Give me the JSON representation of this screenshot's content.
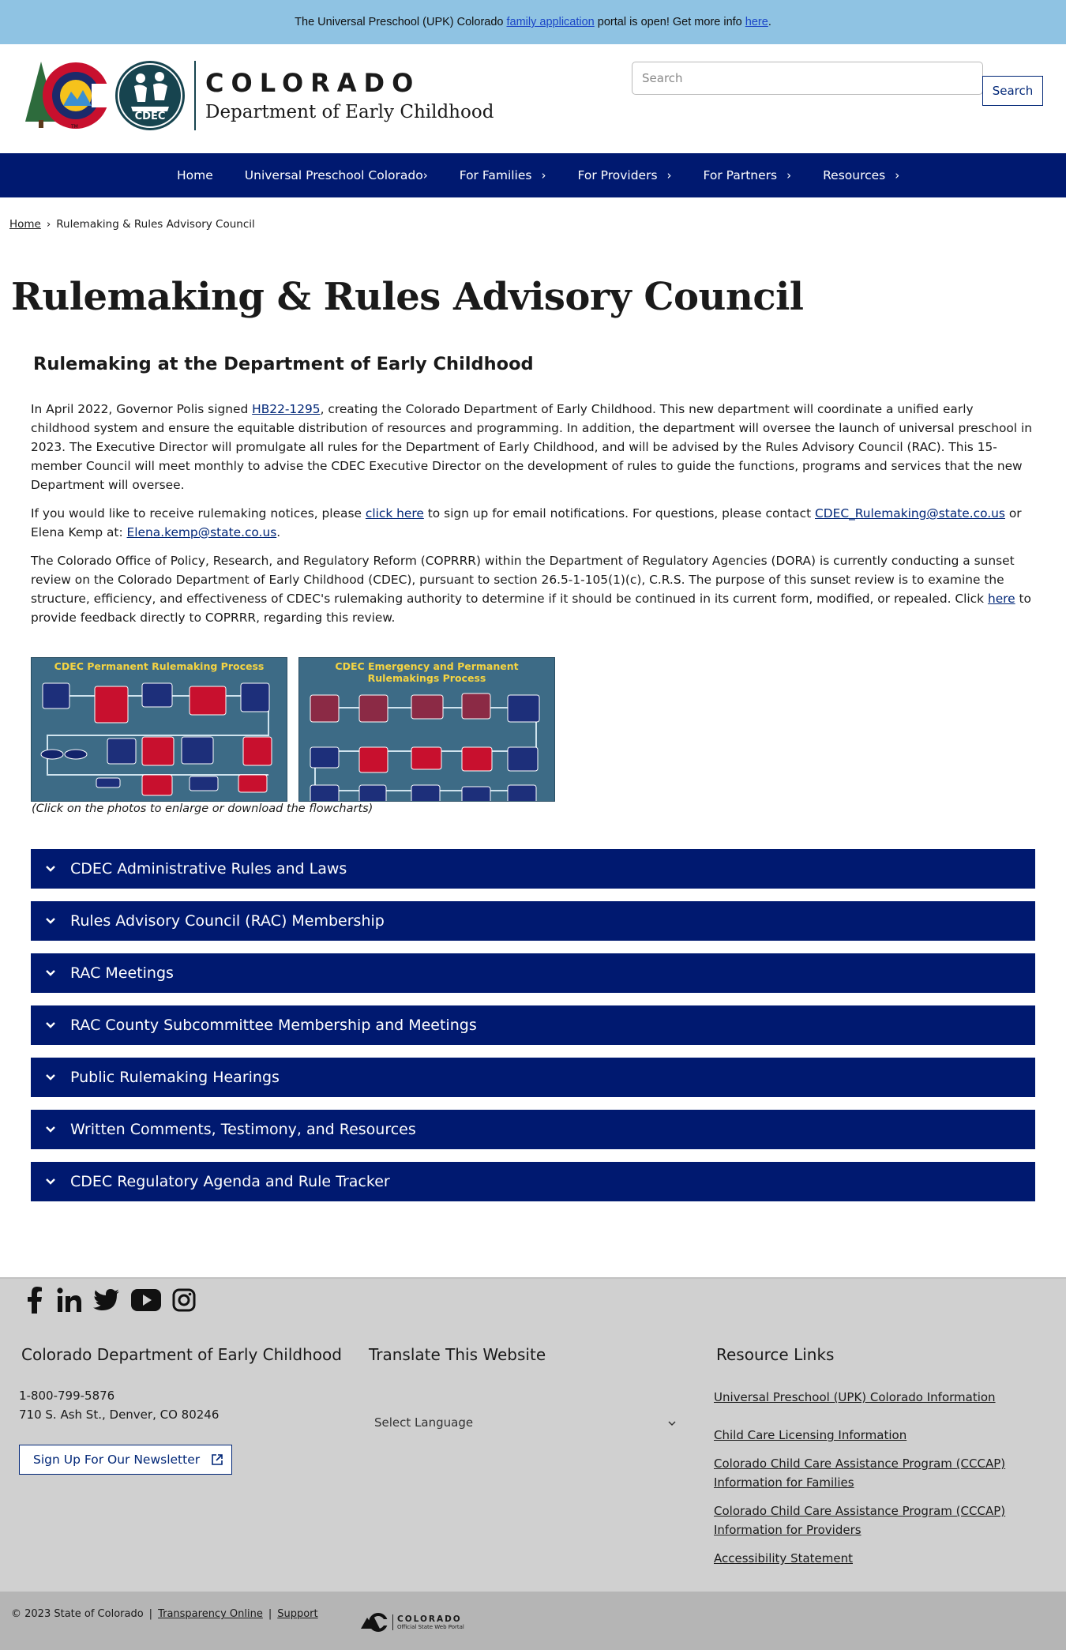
{
  "alert": {
    "pre": "The Universal Preschool (UPK) Colorado",
    "link1": "family application",
    "mid": "portal is open! Get more info",
    "link2": "here",
    "post": "."
  },
  "header": {
    "state": "COLORADO",
    "department": "Department of Early Childhood",
    "seal_text": "CDEC",
    "search_placeholder": "Search",
    "search_button": "Search"
  },
  "nav": {
    "items": [
      {
        "label": "Home"
      },
      {
        "label": "Universal Preschool Colorado"
      },
      {
        "label": "For Families"
      },
      {
        "label": "For Providers"
      },
      {
        "label": "For Partners"
      },
      {
        "label": "Resources"
      }
    ]
  },
  "breadcrumb": {
    "home": "Home",
    "current": "Rulemaking & Rules Advisory Council"
  },
  "page": {
    "title": "Rulemaking & Rules Advisory Council",
    "subtitle": "Rulemaking at the Department of Early Childhood",
    "p1_a": "In April 2022, Governor Polis signed ",
    "p1_link": "HB22-1295",
    "p1_b": ", creating the Colorado Department of Early Childhood. This new department will coordinate a unified early childhood system and ensure the equitable distribution of resources and programming. In addition, the department will oversee the launch of universal preschool in 2023. The Executive Director will promulgate all rules for the Department of Early Childhood, and will be advised by the Rules Advisory Council (RAC). This 15-member Council will meet monthly to advise the CDEC Executive Director on the development of rules to guide the functions, programs and services that the new Department will oversee.",
    "p2_a": "If you would like to receive rulemaking notices, please ",
    "p2_link1": "click here",
    "p2_b": " to sign up for email notifications. For questions, please contact ",
    "p2_link2": "CDEC_Rulemaking@state.co.us",
    "p2_c": " or Elena Kemp at: ",
    "p2_link3": "Elena.kemp@state.co.us",
    "p2_d": ".",
    "p3_a": "The Colorado Office of Policy, Research, and Regulatory Reform (COPRRR) within the Department of Regulatory Agencies (DORA) is currently conducting a sunset review on the Colorado Department of Early Childhood (CDEC), pursuant to section 26.5-1-105(1)(c), C.R.S. The purpose of this sunset review is to examine the structure, efficiency, and effectiveness of CDEC's rulemaking authority to determine if it should be continued in its current form, modified, or repealed. Click ",
    "p3_link": "here",
    "p3_b": " to provide feedback directly to COPRRR, regarding this review.",
    "flow1_title": "CDEC Permanent Rulemaking Process",
    "flow2_title": "CDEC Emergency and Permanent Rulemakings Process",
    "caption": "(Click on the photos to enlarge or download the flowcharts)"
  },
  "accordions": [
    "CDEC Administrative Rules and Laws",
    "Rules Advisory Council (RAC) Membership",
    "RAC Meetings",
    "RAC County Subcommittee Membership and Meetings",
    "Public Rulemaking Hearings",
    "Written Comments, Testimony, and Resources",
    "CDEC Regulatory Agenda and Rule Tracker"
  ],
  "footer": {
    "col1_title": "Colorado Department of Early Childhood",
    "phone": "1-800-799-5876",
    "address": "710 S. Ash St., Denver, CO 80246",
    "newsletter": "Sign Up For Our Newsletter",
    "col2_title": "Translate This Website",
    "select_language": "Select Language",
    "col3_title": "Resource Links",
    "links": [
      "Universal Preschool (UPK) Colorado Information",
      "Child Care Licensing Information",
      "Colorado Child Care Assistance Program (CCCAP) Information for Families",
      "Colorado Child Care Assistance Program (CCCAP) Information for Providers",
      "Accessibility Statement"
    ],
    "social": [
      "facebook-icon",
      "linkedin-icon",
      "twitter-icon",
      "youtube-icon",
      "instagram-icon"
    ]
  },
  "bottom": {
    "copyright": "© 2023 State of Colorado",
    "transparency": "Transparency Online",
    "support": "Support",
    "portal_word": "COLORADO",
    "portal_sub": "Official State Web Portal"
  }
}
